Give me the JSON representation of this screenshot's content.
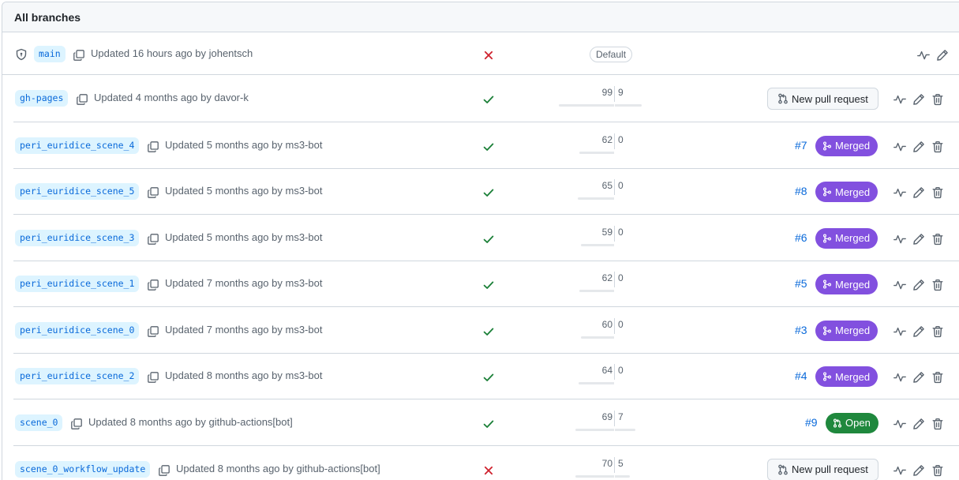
{
  "header": {
    "title": "All branches"
  },
  "labels": {
    "default": "Default",
    "new_pull_request": "New pull request"
  },
  "colors": {
    "link": "#0969da",
    "merged": "#8250df",
    "open": "#1f883d",
    "success": "#1a7f37",
    "failure": "#cf222e"
  },
  "icons": {
    "protected": "shield-icon",
    "copy": "copy-icon",
    "activity": "pulse-icon",
    "edit": "pencil-icon",
    "delete": "trash-icon",
    "check": "check-icon",
    "fail": "x-icon",
    "merged": "git-merge-icon",
    "open": "git-pull-request-icon"
  },
  "branches": [
    {
      "name": "main",
      "updated": "Updated 16 hours ago by johentsch",
      "status": "fail",
      "is_default": true,
      "protected": true
    },
    {
      "name": "gh-pages",
      "updated": "Updated 4 months ago by davor-k",
      "status": "success",
      "behind": "99",
      "ahead": "9",
      "pr": "new"
    },
    {
      "name": "peri_euridice_scene_4",
      "updated": "Updated 5 months ago by ms3-bot",
      "status": "success",
      "behind": "62",
      "ahead": "0",
      "pr_number": "#7",
      "pr_state": "Merged"
    },
    {
      "name": "peri_euridice_scene_5",
      "updated": "Updated 5 months ago by ms3-bot",
      "status": "success",
      "behind": "65",
      "ahead": "0",
      "pr_number": "#8",
      "pr_state": "Merged"
    },
    {
      "name": "peri_euridice_scene_3",
      "updated": "Updated 5 months ago by ms3-bot",
      "status": "success",
      "behind": "59",
      "ahead": "0",
      "pr_number": "#6",
      "pr_state": "Merged"
    },
    {
      "name": "peri_euridice_scene_1",
      "updated": "Updated 7 months ago by ms3-bot",
      "status": "success",
      "behind": "62",
      "ahead": "0",
      "pr_number": "#5",
      "pr_state": "Merged"
    },
    {
      "name": "peri_euridice_scene_0",
      "updated": "Updated 7 months ago by ms3-bot",
      "status": "success",
      "behind": "60",
      "ahead": "0",
      "pr_number": "#3",
      "pr_state": "Merged"
    },
    {
      "name": "peri_euridice_scene_2",
      "updated": "Updated 8 months ago by ms3-bot",
      "status": "success",
      "behind": "64",
      "ahead": "0",
      "pr_number": "#4",
      "pr_state": "Merged"
    },
    {
      "name": "scene_0",
      "updated": "Updated 8 months ago by github-actions[bot]",
      "status": "success",
      "behind": "69",
      "ahead": "7",
      "pr_number": "#9",
      "pr_state": "Open"
    },
    {
      "name": "scene_0_workflow_update",
      "updated": "Updated 8 months ago by github-actions[bot]",
      "status": "fail",
      "behind": "70",
      "ahead": "5",
      "pr": "new"
    }
  ]
}
